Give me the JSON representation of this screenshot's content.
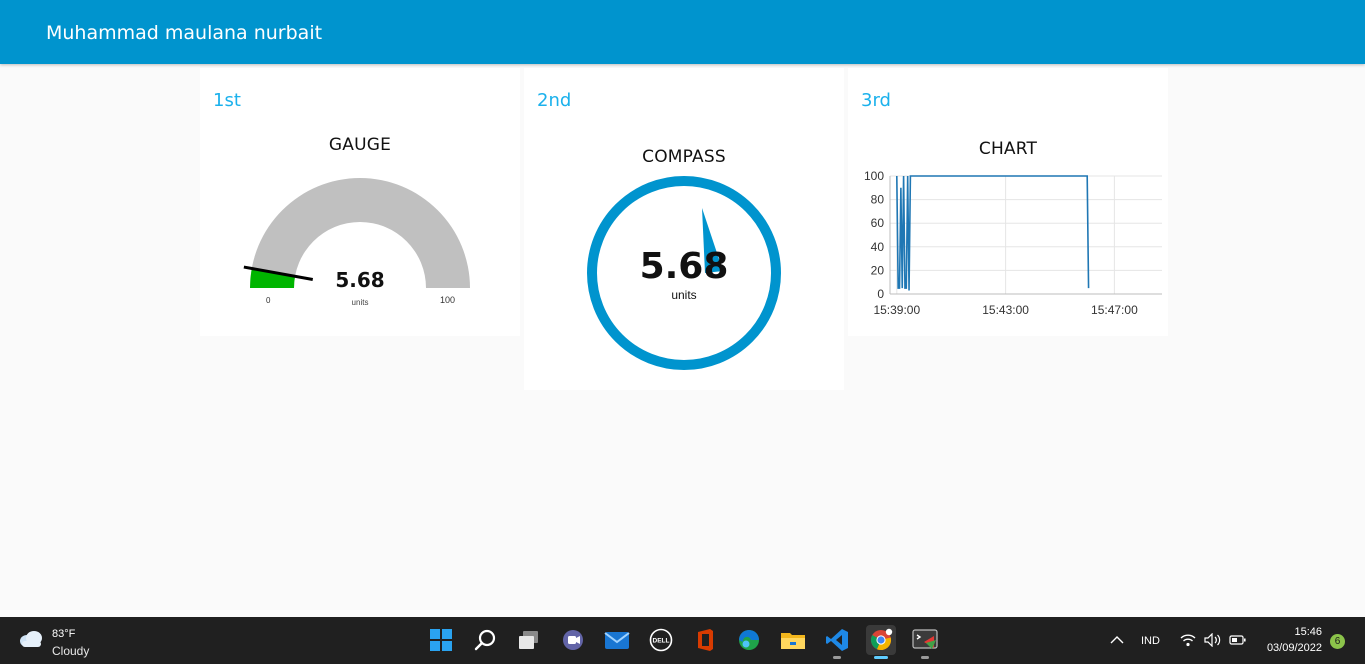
{
  "header": {
    "title": "Muhammad maulana nurbait"
  },
  "cards": [
    {
      "title": "1st"
    },
    {
      "title": "2nd"
    },
    {
      "title": "3rd"
    }
  ],
  "gauge": {
    "title": "GAUGE",
    "value": "5.68",
    "value_num": 5.68,
    "units": "units",
    "min": "0",
    "max": "100",
    "min_num": 0,
    "max_num": 100,
    "fill_color": "#00b500",
    "track_color": "#c0c0c0"
  },
  "compass": {
    "title": "COMPASS",
    "value": "5.68",
    "units": "units",
    "color": "#0094ce"
  },
  "chart": {
    "title": "CHART",
    "yticks": [
      "100",
      "80",
      "60",
      "40",
      "20",
      "0"
    ],
    "xticks": [
      "15:39:00",
      "15:43:00",
      "15:47:00"
    ],
    "line_color": "#1f77b4"
  },
  "chart_data": {
    "type": "line",
    "title": "CHART",
    "xlabel": "",
    "ylabel": "",
    "ylim": [
      0,
      100
    ],
    "xlim": [
      "15:38:45",
      "15:48:45"
    ],
    "x_tick_labels": [
      "15:39:00",
      "15:43:00",
      "15:47:00"
    ],
    "y_tick_labels": [
      "0",
      "20",
      "40",
      "60",
      "80",
      "100"
    ],
    "grid": true,
    "series": [
      {
        "x": [
          "15:39:00",
          "15:39:03",
          "15:39:06",
          "15:39:09",
          "15:39:12",
          "15:39:15",
          "15:39:18",
          "15:39:21",
          "15:39:24",
          "15:39:27",
          "15:39:30",
          "15:39:33",
          "15:46:00",
          "15:46:03"
        ],
        "y": [
          100,
          5,
          5,
          90,
          5,
          100,
          5,
          5,
          100,
          3,
          100,
          100,
          100,
          5
        ]
      }
    ]
  },
  "taskbar": {
    "weather_temp": "83°F",
    "weather_cond": "Cloudy",
    "apps": [
      "start-icon",
      "search-icon",
      "task-view-icon",
      "teams-icon",
      "mail-icon",
      "dell-icon",
      "office-icon",
      "edge-icon",
      "file-explorer-icon",
      "vscode-icon",
      "chrome-icon",
      "terminal-icon"
    ],
    "language": "IND",
    "time": "15:46",
    "date": "03/09/2022",
    "notification_count": "6"
  }
}
